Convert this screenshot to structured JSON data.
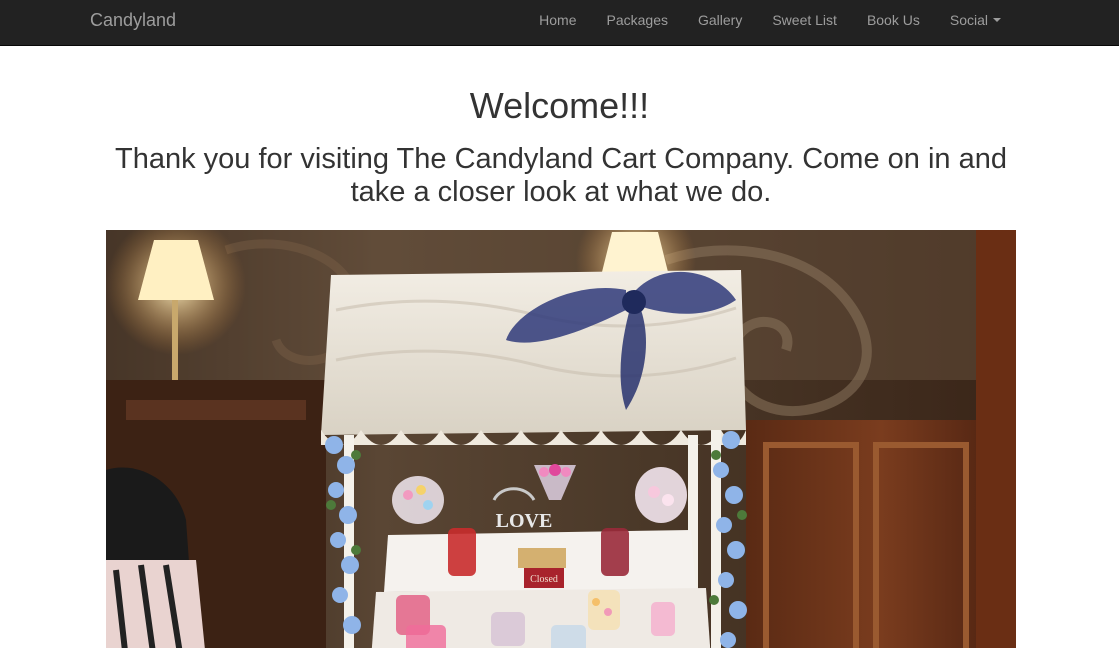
{
  "navbar": {
    "brand": "Candyland",
    "items": [
      {
        "label": "Home"
      },
      {
        "label": "Packages"
      },
      {
        "label": "Gallery"
      },
      {
        "label": "Sweet List"
      },
      {
        "label": "Book Us"
      },
      {
        "label": "Social",
        "dropdown": true
      }
    ],
    "colors": {
      "background": "#222222",
      "text": "#9d9d9d"
    }
  },
  "main": {
    "heading": "Welcome!!!",
    "subheading": "Thank you for visiting The Candyland Cart Company. Come on in and take a closer look at what we do.",
    "photo": {
      "subject": "candy-cart-photo",
      "sign_text": "LOVE",
      "small_sign_text": "Closed"
    }
  }
}
